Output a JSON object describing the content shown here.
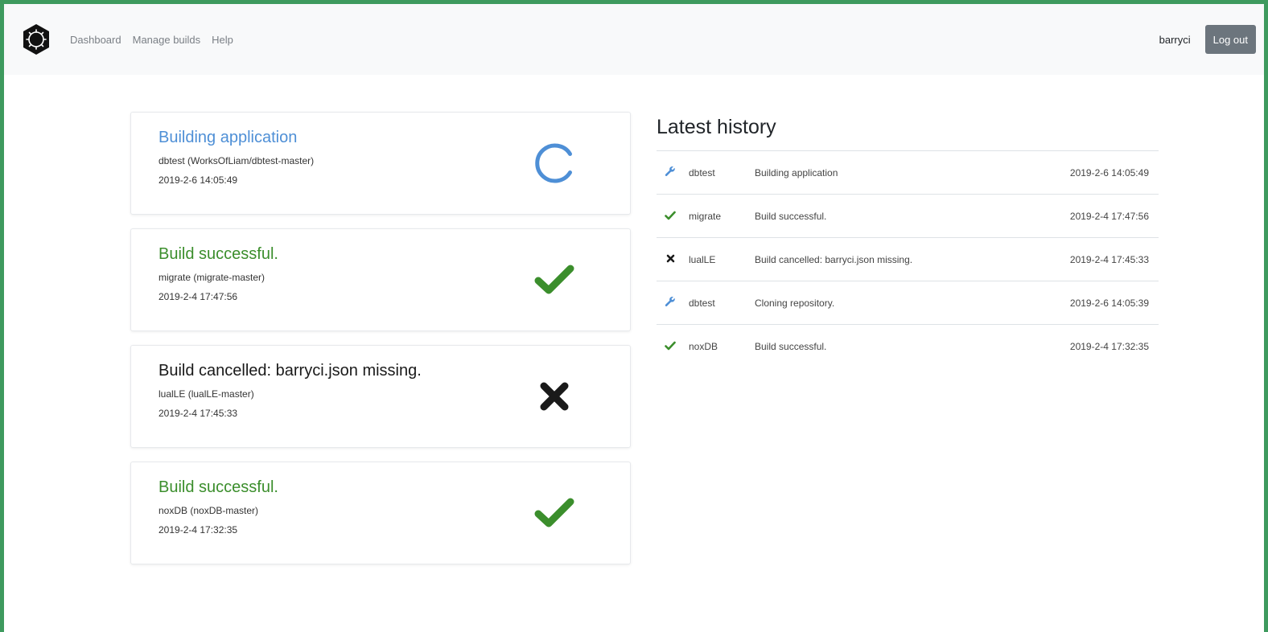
{
  "nav": {
    "links": [
      "Dashboard",
      "Manage builds",
      "Help"
    ],
    "username": "barryci",
    "logout_label": "Log out"
  },
  "cards": [
    {
      "title": "Building application",
      "subtitle": "dbtest (WorksOfLiam/dbtest-master)",
      "time": "2019-2-6 14:05:49",
      "status": "building",
      "icon": "spinner-icon"
    },
    {
      "title": "Build successful.",
      "subtitle": "migrate (migrate-master)",
      "time": "2019-2-4 17:47:56",
      "status": "success",
      "icon": "check-icon"
    },
    {
      "title": "Build cancelled: barryci.json missing.",
      "subtitle": "lualLE (lualLE-master)",
      "time": "2019-2-4 17:45:33",
      "status": "cancelled",
      "icon": "x-icon"
    },
    {
      "title": "Build successful.",
      "subtitle": "noxDB (noxDB-master)",
      "time": "2019-2-4 17:32:35",
      "status": "success",
      "icon": "check-icon"
    }
  ],
  "history": {
    "title": "Latest history",
    "rows": [
      {
        "icon": "wrench-icon",
        "name": "dbtest",
        "message": "Building application",
        "time": "2019-2-6 14:05:49"
      },
      {
        "icon": "check-icon",
        "name": "migrate",
        "message": "Build successful.",
        "time": "2019-2-4 17:47:56"
      },
      {
        "icon": "x-icon",
        "name": "lualLE",
        "message": "Build cancelled: barryci.json missing.",
        "time": "2019-2-4 17:45:33"
      },
      {
        "icon": "wrench-icon",
        "name": "dbtest",
        "message": "Cloning repository.",
        "time": "2019-2-6 14:05:39"
      },
      {
        "icon": "check-icon",
        "name": "noxDB",
        "message": "Build successful.",
        "time": "2019-2-4 17:32:35"
      }
    ]
  },
  "colors": {
    "building": "#4e8fd6",
    "success": "#3b8e2c",
    "cancelled": "#1a1a1a",
    "frame": "#3e9a5e",
    "logout_button": "#6c757d"
  }
}
